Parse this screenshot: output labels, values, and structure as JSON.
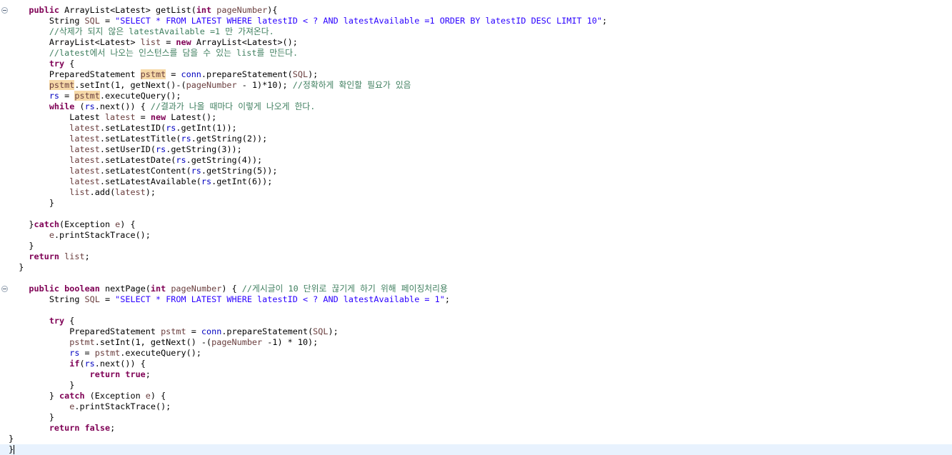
{
  "editor": {
    "lines": [
      {
        "fold": true,
        "tokens": [
          {
            "t": "    "
          },
          {
            "t": "public",
            "c": "kw"
          },
          {
            "t": " ArrayList<Latest> getList("
          },
          {
            "t": "int",
            "c": "kw"
          },
          {
            "t": " "
          },
          {
            "t": "pageNumber",
            "c": "var"
          },
          {
            "t": "){"
          }
        ]
      },
      {
        "tokens": [
          {
            "t": "        String "
          },
          {
            "t": "SQL",
            "c": "var"
          },
          {
            "t": " = "
          },
          {
            "t": "\"SELECT * FROM LATEST WHERE latestID < ? AND latestAvailable =1 ORDER BY latestID DESC LIMIT 10\"",
            "c": "str"
          },
          {
            "t": ";"
          }
        ]
      },
      {
        "tokens": [
          {
            "t": "        "
          },
          {
            "t": "//삭제가 되지 않은 latestAvailable =1 만 가져온다.",
            "c": "cm"
          }
        ]
      },
      {
        "tokens": [
          {
            "t": "        ArrayList<Latest> "
          },
          {
            "t": "list",
            "c": "var"
          },
          {
            "t": " = "
          },
          {
            "t": "new",
            "c": "kw"
          },
          {
            "t": " ArrayList<Latest>();"
          }
        ]
      },
      {
        "tokens": [
          {
            "t": "        "
          },
          {
            "t": "//latest에서 나오는 인스턴스를 담을 수 있는 list를 만든다.",
            "c": "cm"
          }
        ]
      },
      {
        "tokens": [
          {
            "t": "        "
          },
          {
            "t": "try",
            "c": "kw"
          },
          {
            "t": " {"
          }
        ]
      },
      {
        "tokens": [
          {
            "t": "        PreparedStatement "
          },
          {
            "t": "pstmt",
            "c": "var occ"
          },
          {
            "t": " = "
          },
          {
            "t": "conn",
            "c": "fld"
          },
          {
            "t": ".prepareStatement("
          },
          {
            "t": "SQL",
            "c": "var"
          },
          {
            "t": ");"
          }
        ]
      },
      {
        "tokens": [
          {
            "t": "        "
          },
          {
            "t": "pstmt",
            "c": "var occ"
          },
          {
            "t": ".setInt(1, getNext()-("
          },
          {
            "t": "pageNumber",
            "c": "var"
          },
          {
            "t": " - 1)*10); "
          },
          {
            "t": "//정확하게 확인할 필요가 있음",
            "c": "cm"
          }
        ]
      },
      {
        "tokens": [
          {
            "t": "        "
          },
          {
            "t": "rs",
            "c": "fld"
          },
          {
            "t": " = "
          },
          {
            "t": "pstmt",
            "c": "var occ"
          },
          {
            "t": ".executeQuery();"
          }
        ]
      },
      {
        "tokens": [
          {
            "t": "        "
          },
          {
            "t": "while",
            "c": "kw"
          },
          {
            "t": " ("
          },
          {
            "t": "rs",
            "c": "fld"
          },
          {
            "t": ".next()) { "
          },
          {
            "t": "//결과가 나올 때마다 이렇게 나오게 한다.",
            "c": "cm"
          }
        ]
      },
      {
        "tokens": [
          {
            "t": "            Latest "
          },
          {
            "t": "latest",
            "c": "var"
          },
          {
            "t": " = "
          },
          {
            "t": "new",
            "c": "kw"
          },
          {
            "t": " Latest();"
          }
        ]
      },
      {
        "tokens": [
          {
            "t": "            "
          },
          {
            "t": "latest",
            "c": "var"
          },
          {
            "t": ".setLatestID("
          },
          {
            "t": "rs",
            "c": "fld"
          },
          {
            "t": ".getInt(1));"
          }
        ]
      },
      {
        "tokens": [
          {
            "t": "            "
          },
          {
            "t": "latest",
            "c": "var"
          },
          {
            "t": ".setLatestTitle("
          },
          {
            "t": "rs",
            "c": "fld"
          },
          {
            "t": ".getString(2));"
          }
        ]
      },
      {
        "tokens": [
          {
            "t": "            "
          },
          {
            "t": "latest",
            "c": "var"
          },
          {
            "t": ".setUserID("
          },
          {
            "t": "rs",
            "c": "fld"
          },
          {
            "t": ".getString(3));"
          }
        ]
      },
      {
        "tokens": [
          {
            "t": "            "
          },
          {
            "t": "latest",
            "c": "var"
          },
          {
            "t": ".setLatestDate("
          },
          {
            "t": "rs",
            "c": "fld"
          },
          {
            "t": ".getString(4));"
          }
        ]
      },
      {
        "tokens": [
          {
            "t": "            "
          },
          {
            "t": "latest",
            "c": "var"
          },
          {
            "t": ".setLatestContent("
          },
          {
            "t": "rs",
            "c": "fld"
          },
          {
            "t": ".getString(5));"
          }
        ]
      },
      {
        "tokens": [
          {
            "t": "            "
          },
          {
            "t": "latest",
            "c": "var"
          },
          {
            "t": ".setLatestAvailable("
          },
          {
            "t": "rs",
            "c": "fld"
          },
          {
            "t": ".getInt(6));"
          }
        ]
      },
      {
        "tokens": [
          {
            "t": "            "
          },
          {
            "t": "list",
            "c": "var"
          },
          {
            "t": ".add("
          },
          {
            "t": "latest",
            "c": "var"
          },
          {
            "t": ");"
          }
        ]
      },
      {
        "tokens": [
          {
            "t": "        }"
          }
        ]
      },
      {
        "tokens": [
          {
            "t": ""
          }
        ]
      },
      {
        "tokens": [
          {
            "t": "    }"
          },
          {
            "t": "catch",
            "c": "kw"
          },
          {
            "t": "(Exception "
          },
          {
            "t": "e",
            "c": "var"
          },
          {
            "t": ") {"
          }
        ]
      },
      {
        "tokens": [
          {
            "t": "        "
          },
          {
            "t": "e",
            "c": "var"
          },
          {
            "t": ".printStackTrace();"
          }
        ]
      },
      {
        "tokens": [
          {
            "t": "    }"
          }
        ]
      },
      {
        "tokens": [
          {
            "t": "    "
          },
          {
            "t": "return",
            "c": "kw"
          },
          {
            "t": " "
          },
          {
            "t": "list",
            "c": "var"
          },
          {
            "t": ";"
          }
        ]
      },
      {
        "tokens": [
          {
            "t": "  }"
          }
        ]
      },
      {
        "tokens": [
          {
            "t": ""
          }
        ]
      },
      {
        "fold": true,
        "tokens": [
          {
            "t": "    "
          },
          {
            "t": "public",
            "c": "kw"
          },
          {
            "t": " "
          },
          {
            "t": "boolean",
            "c": "kw"
          },
          {
            "t": " nextPage("
          },
          {
            "t": "int",
            "c": "kw"
          },
          {
            "t": " "
          },
          {
            "t": "pageNumber",
            "c": "var"
          },
          {
            "t": ") { "
          },
          {
            "t": "//게시글이 10 단위로 끊기게 하기 위해 페이징처리용",
            "c": "cm"
          }
        ]
      },
      {
        "tokens": [
          {
            "t": "        String "
          },
          {
            "t": "SQL",
            "c": "var"
          },
          {
            "t": " = "
          },
          {
            "t": "\"SELECT * FROM LATEST WHERE latestID < ? AND latestAvailable = 1\"",
            "c": "str"
          },
          {
            "t": ";"
          }
        ]
      },
      {
        "tokens": [
          {
            "t": ""
          }
        ]
      },
      {
        "tokens": [
          {
            "t": "        "
          },
          {
            "t": "try",
            "c": "kw"
          },
          {
            "t": " {"
          }
        ]
      },
      {
        "tokens": [
          {
            "t": "            PreparedStatement "
          },
          {
            "t": "pstmt",
            "c": "var"
          },
          {
            "t": " = "
          },
          {
            "t": "conn",
            "c": "fld"
          },
          {
            "t": ".prepareStatement("
          },
          {
            "t": "SQL",
            "c": "var"
          },
          {
            "t": ");"
          }
        ]
      },
      {
        "tokens": [
          {
            "t": "            "
          },
          {
            "t": "pstmt",
            "c": "var"
          },
          {
            "t": ".setInt(1, getNext() -("
          },
          {
            "t": "pageNumber",
            "c": "var"
          },
          {
            "t": " -1) * 10);"
          }
        ]
      },
      {
        "tokens": [
          {
            "t": "            "
          },
          {
            "t": "rs",
            "c": "fld"
          },
          {
            "t": " = "
          },
          {
            "t": "pstmt",
            "c": "var"
          },
          {
            "t": ".executeQuery();"
          }
        ]
      },
      {
        "tokens": [
          {
            "t": "            "
          },
          {
            "t": "if",
            "c": "kw"
          },
          {
            "t": "("
          },
          {
            "t": "rs",
            "c": "fld"
          },
          {
            "t": ".next()) {"
          }
        ]
      },
      {
        "tokens": [
          {
            "t": "                "
          },
          {
            "t": "return",
            "c": "kw"
          },
          {
            "t": " "
          },
          {
            "t": "true",
            "c": "kw"
          },
          {
            "t": ";"
          }
        ]
      },
      {
        "tokens": [
          {
            "t": "            }"
          }
        ]
      },
      {
        "tokens": [
          {
            "t": "        } "
          },
          {
            "t": "catch",
            "c": "kw"
          },
          {
            "t": " (Exception "
          },
          {
            "t": "e",
            "c": "var"
          },
          {
            "t": ") {"
          }
        ]
      },
      {
        "tokens": [
          {
            "t": "            "
          },
          {
            "t": "e",
            "c": "var"
          },
          {
            "t": ".printStackTrace();"
          }
        ]
      },
      {
        "tokens": [
          {
            "t": "        }"
          }
        ]
      },
      {
        "tokens": [
          {
            "t": "        "
          },
          {
            "t": "return",
            "c": "kw"
          },
          {
            "t": " "
          },
          {
            "t": "false",
            "c": "kw"
          },
          {
            "t": ";"
          }
        ]
      },
      {
        "tokens": [
          {
            "t": "}"
          }
        ]
      },
      {
        "current": true,
        "tokens": [
          {
            "t": "}"
          }
        ]
      }
    ]
  }
}
